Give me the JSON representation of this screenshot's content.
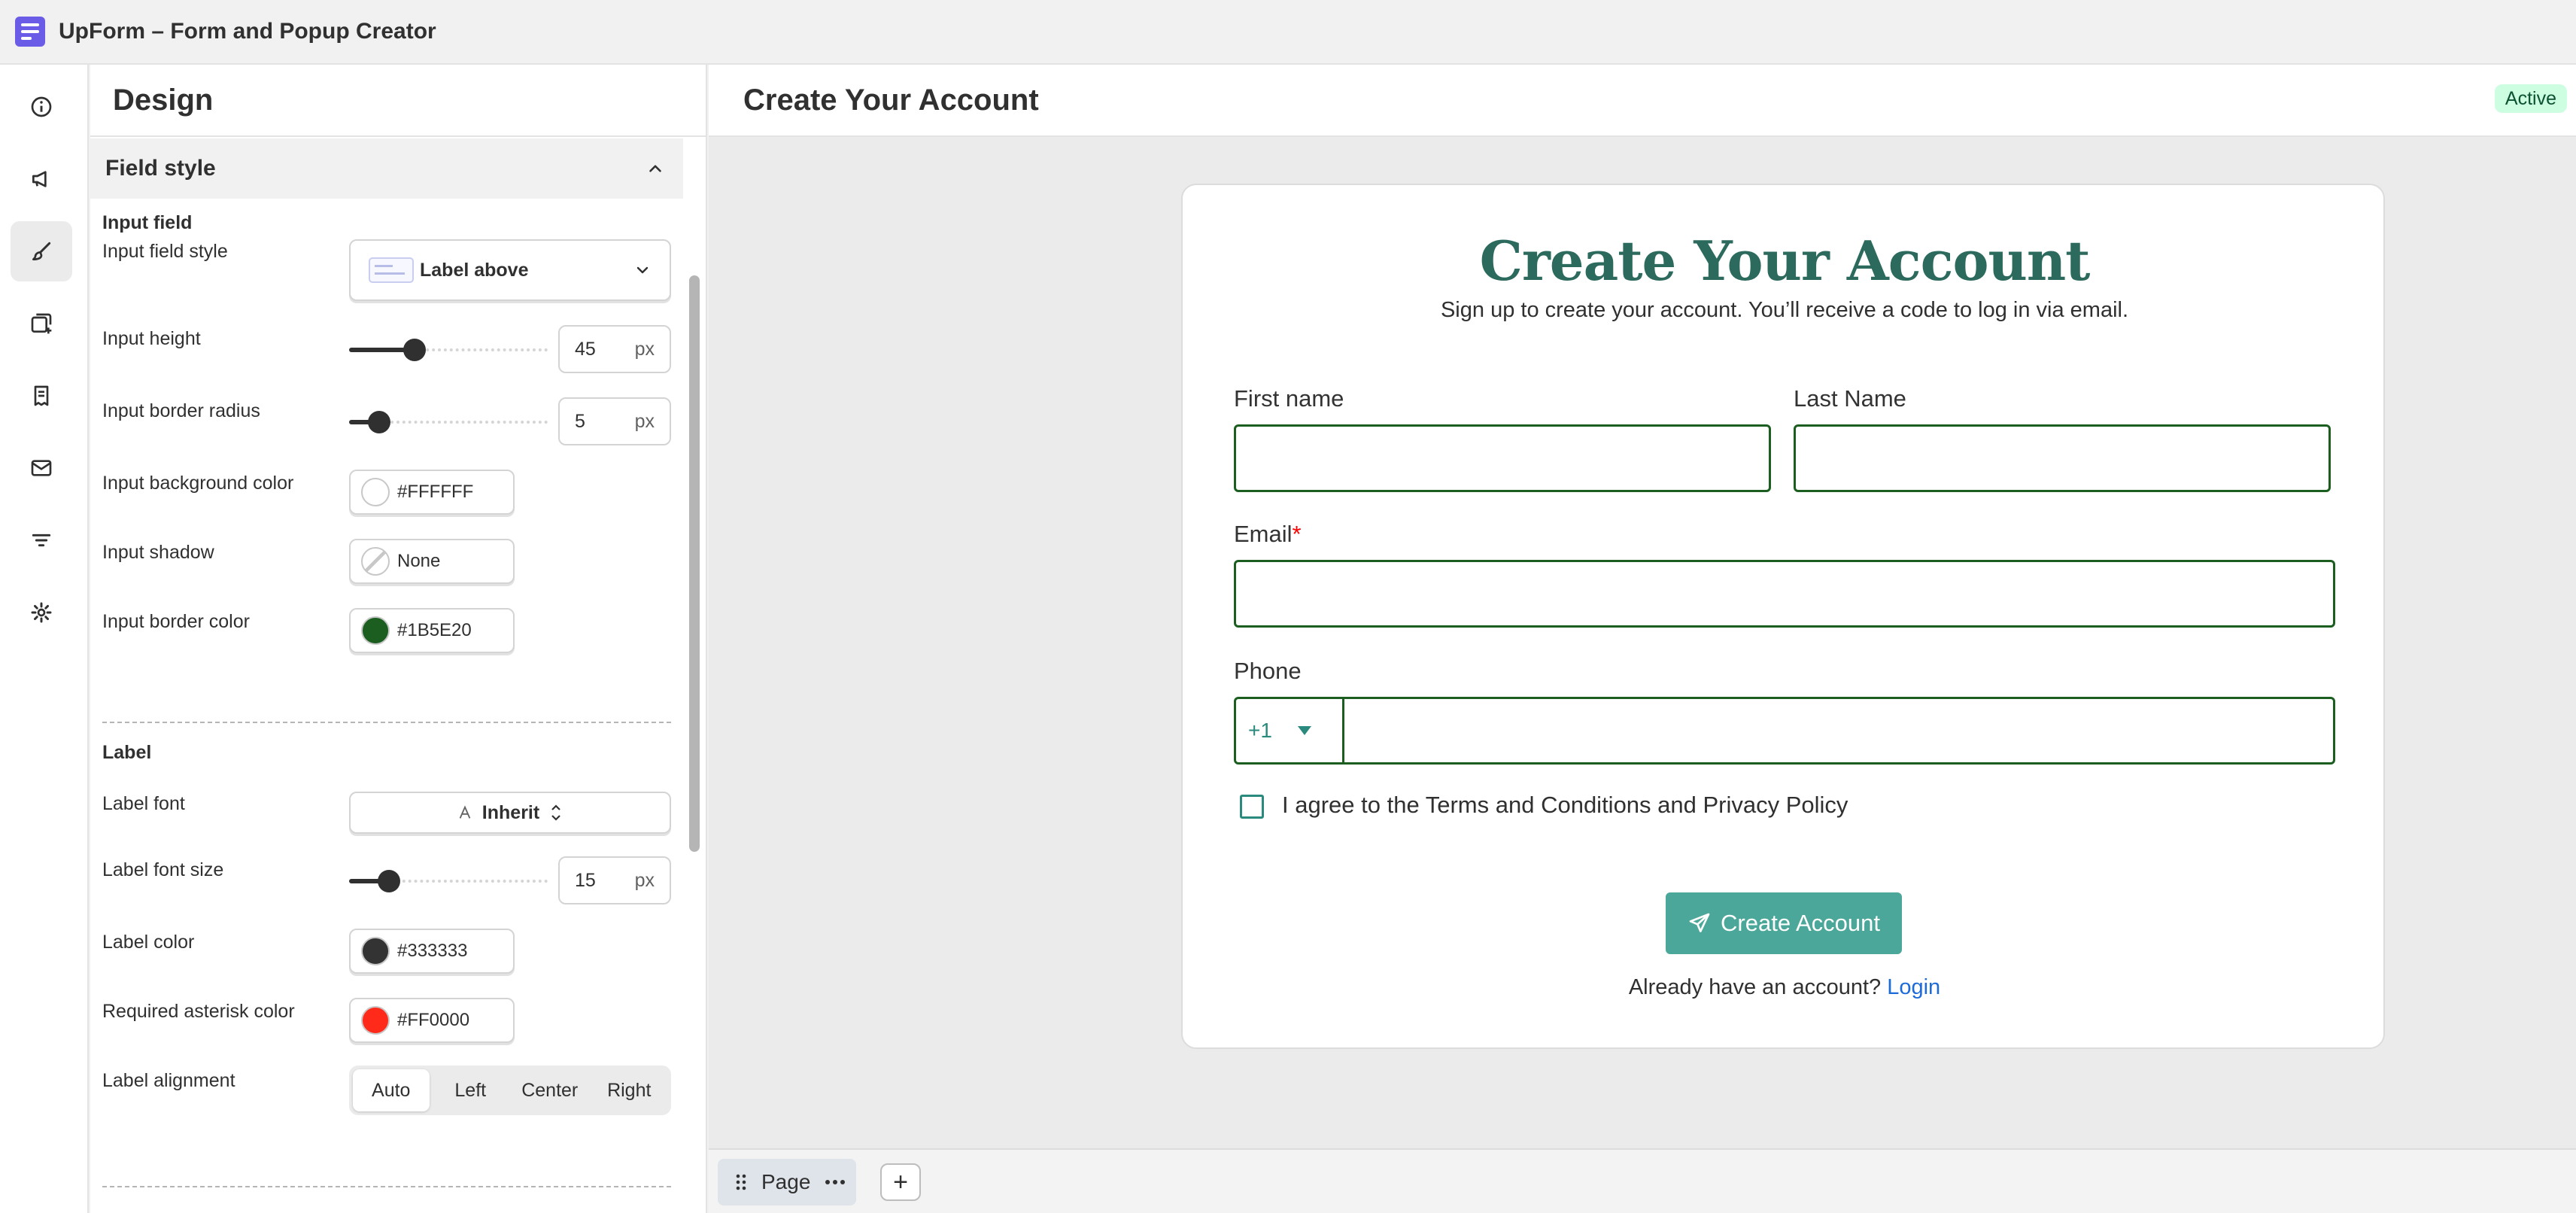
{
  "app": {
    "title": "UpForm – Form and Popup Creator"
  },
  "rail": {
    "items": [
      "info-icon",
      "megaphone-icon",
      "brush-icon",
      "add-form-icon",
      "receipt-icon",
      "mail-icon",
      "filter-icon",
      "gear-icon"
    ],
    "active": "brush-icon"
  },
  "panel": {
    "title": "Design",
    "section": "Field style",
    "input_group": {
      "title": "Input field",
      "style_label": "Input field style",
      "style_value": "Label above",
      "height_label": "Input height",
      "height_value": "45",
      "height_fraction": 0.33,
      "radius_label": "Input border radius",
      "radius_value": "5",
      "radius_fraction": 0.15,
      "bg_label": "Input background color",
      "bg_value": "#FFFFFF",
      "shadow_label": "Input shadow",
      "shadow_value": "None",
      "border_label": "Input border color",
      "border_value": "#1B5E20"
    },
    "label_group": {
      "title": "Label",
      "font_label": "Label font",
      "font_value": "Inherit",
      "size_label": "Label font size",
      "size_value": "15",
      "size_fraction": 0.2,
      "color_label": "Label color",
      "color_value": "#333333",
      "asterisk_label": "Required asterisk color",
      "asterisk_value": "#FF0000",
      "align_label": "Label alignment",
      "align_options": [
        "Auto",
        "Left",
        "Center",
        "Right"
      ],
      "align_selected": "Auto"
    },
    "unit": "px"
  },
  "main": {
    "title": "Create Your Account",
    "status": "Active",
    "form": {
      "title": "Create Your Account",
      "subtitle": "Sign up to create your account. You’ll receive a code to log in via email.",
      "first_name_label": "First name",
      "last_name_label": "Last Name",
      "email_label": "Email",
      "required_mark": "*",
      "phone_label": "Phone",
      "phone_code": "+1",
      "consent": "I agree to the Terms and Conditions and Privacy Policy",
      "submit": "Create Account",
      "login_prompt": "Already have an account?",
      "login_link": "Login"
    },
    "page_tab": "Page",
    "add_symbol": "+"
  },
  "colors": {
    "accent": "#4aa799",
    "title": "#2b6a5c",
    "border": "#1B5E20",
    "asterisk": "#FF0000",
    "badge_bg": "#cdfee1"
  }
}
